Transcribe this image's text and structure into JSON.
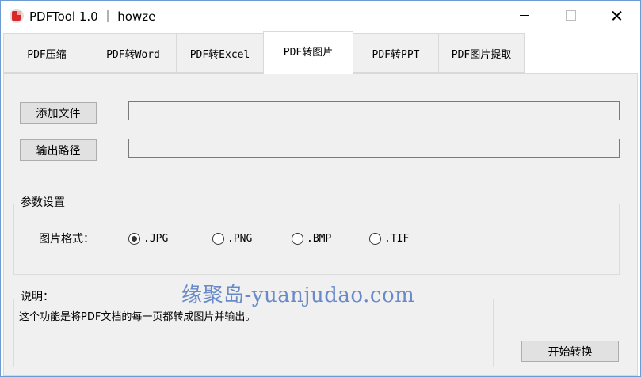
{
  "window": {
    "title": "PDFTool 1.0 ｜ howze"
  },
  "tabs": [
    {
      "label": "PDF压缩",
      "active": false
    },
    {
      "label": "PDF转Word",
      "active": false
    },
    {
      "label": "PDF转Excel",
      "active": false
    },
    {
      "label": "PDF转图片",
      "active": true
    },
    {
      "label": "PDF转PPT",
      "active": false
    },
    {
      "label": "PDF图片提取",
      "active": false
    }
  ],
  "files": {
    "add_label": "添加文件",
    "add_path": "",
    "output_label": "输出路径",
    "output_path": ""
  },
  "params": {
    "group_title": "参数设置",
    "format_label": "图片格式：",
    "formats": [
      {
        "label": ".JPG",
        "checked": true
      },
      {
        "label": ".PNG",
        "checked": false
      },
      {
        "label": ".BMP",
        "checked": false
      },
      {
        "label": ".TIF",
        "checked": false
      }
    ]
  },
  "note": {
    "group_title": "说明：",
    "text": "这个功能是将PDF文档的每一页都转成图片并输出。"
  },
  "actions": {
    "start_label": "开始转换"
  },
  "watermark": "缘聚岛-yuanjudao.com",
  "colors": {
    "window_border": "#6b9bd1",
    "panel_bg": "#f0f0f0",
    "watermark": "#5b7fc4"
  }
}
